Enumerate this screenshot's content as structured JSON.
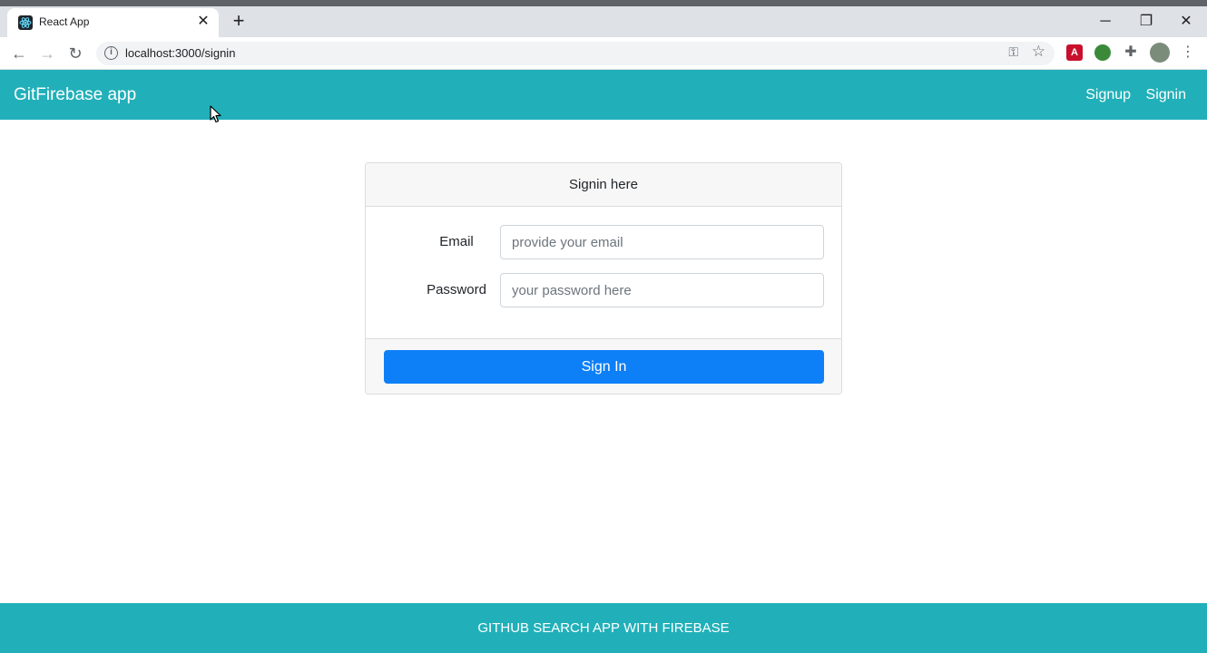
{
  "browser": {
    "tab_title": "React App",
    "tab_close": "✕",
    "new_tab": "+",
    "url": "localhost:3000/signin",
    "window_controls": {
      "minimize": "─",
      "restore": "❐",
      "close": "✕"
    }
  },
  "navbar": {
    "brand": "GitFirebase app",
    "links": [
      {
        "label": "Signup"
      },
      {
        "label": "Signin"
      }
    ]
  },
  "form": {
    "header": "Signin here",
    "email_label": "Email",
    "email_placeholder": "provide your email",
    "email_value": "",
    "password_label": "Password",
    "password_placeholder": "your password here",
    "password_value": "",
    "submit_label": "Sign In"
  },
  "footer": {
    "text": "GITHUB SEARCH APP WITH FIREBASE"
  },
  "colors": {
    "navbar": "#21b0b9",
    "primary_button": "#0d7ff7"
  }
}
